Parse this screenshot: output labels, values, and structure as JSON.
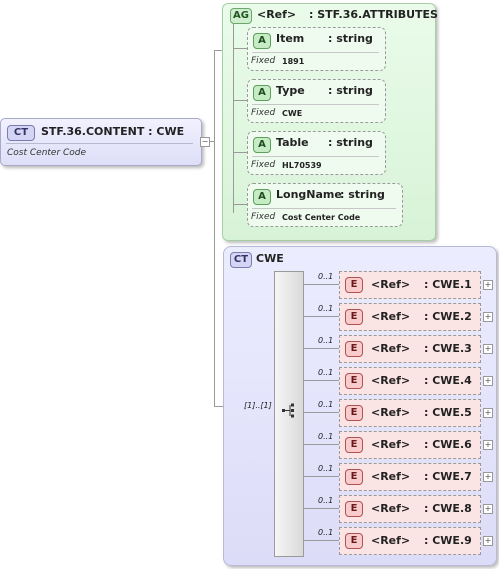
{
  "root": {
    "badge": "CT",
    "title": "STF.36.CONTENT : CWE",
    "doc": "Cost Center Code"
  },
  "attribute_group": {
    "badge": "AG",
    "ref": "<Ref>",
    "name": ": STF.36.ATTRIBUTES",
    "attributes": [
      {
        "badge": "A",
        "name": "Item",
        "type": ": string",
        "fixed_label": "Fixed",
        "fixed_value": "1891"
      },
      {
        "badge": "A",
        "name": "Type",
        "type": ": string",
        "fixed_label": "Fixed",
        "fixed_value": "CWE"
      },
      {
        "badge": "A",
        "name": "Table",
        "type": ": string",
        "fixed_label": "Fixed",
        "fixed_value": "HL70539"
      },
      {
        "badge": "A",
        "name": "LongName",
        "type": ": string",
        "fixed_label": "Fixed",
        "fixed_value": "Cost Center Code"
      }
    ]
  },
  "complex_type": {
    "badge": "CT",
    "name": "CWE",
    "sequence_occurrence": "[1]..[1]",
    "elements": [
      {
        "occ": "0..1",
        "badge": "E",
        "ref": "<Ref>",
        "name": ": CWE.1"
      },
      {
        "occ": "0..1",
        "badge": "E",
        "ref": "<Ref>",
        "name": ": CWE.2"
      },
      {
        "occ": "0..1",
        "badge": "E",
        "ref": "<Ref>",
        "name": ": CWE.3"
      },
      {
        "occ": "0..1",
        "badge": "E",
        "ref": "<Ref>",
        "name": ": CWE.4"
      },
      {
        "occ": "0..1",
        "badge": "E",
        "ref": "<Ref>",
        "name": ": CWE.5"
      },
      {
        "occ": "0..1",
        "badge": "E",
        "ref": "<Ref>",
        "name": ": CWE.6"
      },
      {
        "occ": "0..1",
        "badge": "E",
        "ref": "<Ref>",
        "name": ": CWE.7"
      },
      {
        "occ": "0..1",
        "badge": "E",
        "ref": "<Ref>",
        "name": ": CWE.8"
      },
      {
        "occ": "0..1",
        "badge": "E",
        "ref": "<Ref>",
        "name": ": CWE.9"
      }
    ]
  },
  "colors": {
    "ct": "#dedef8",
    "ag": "#d7f3d7",
    "attr": "#eefbee",
    "element": "#fbe4e4"
  }
}
